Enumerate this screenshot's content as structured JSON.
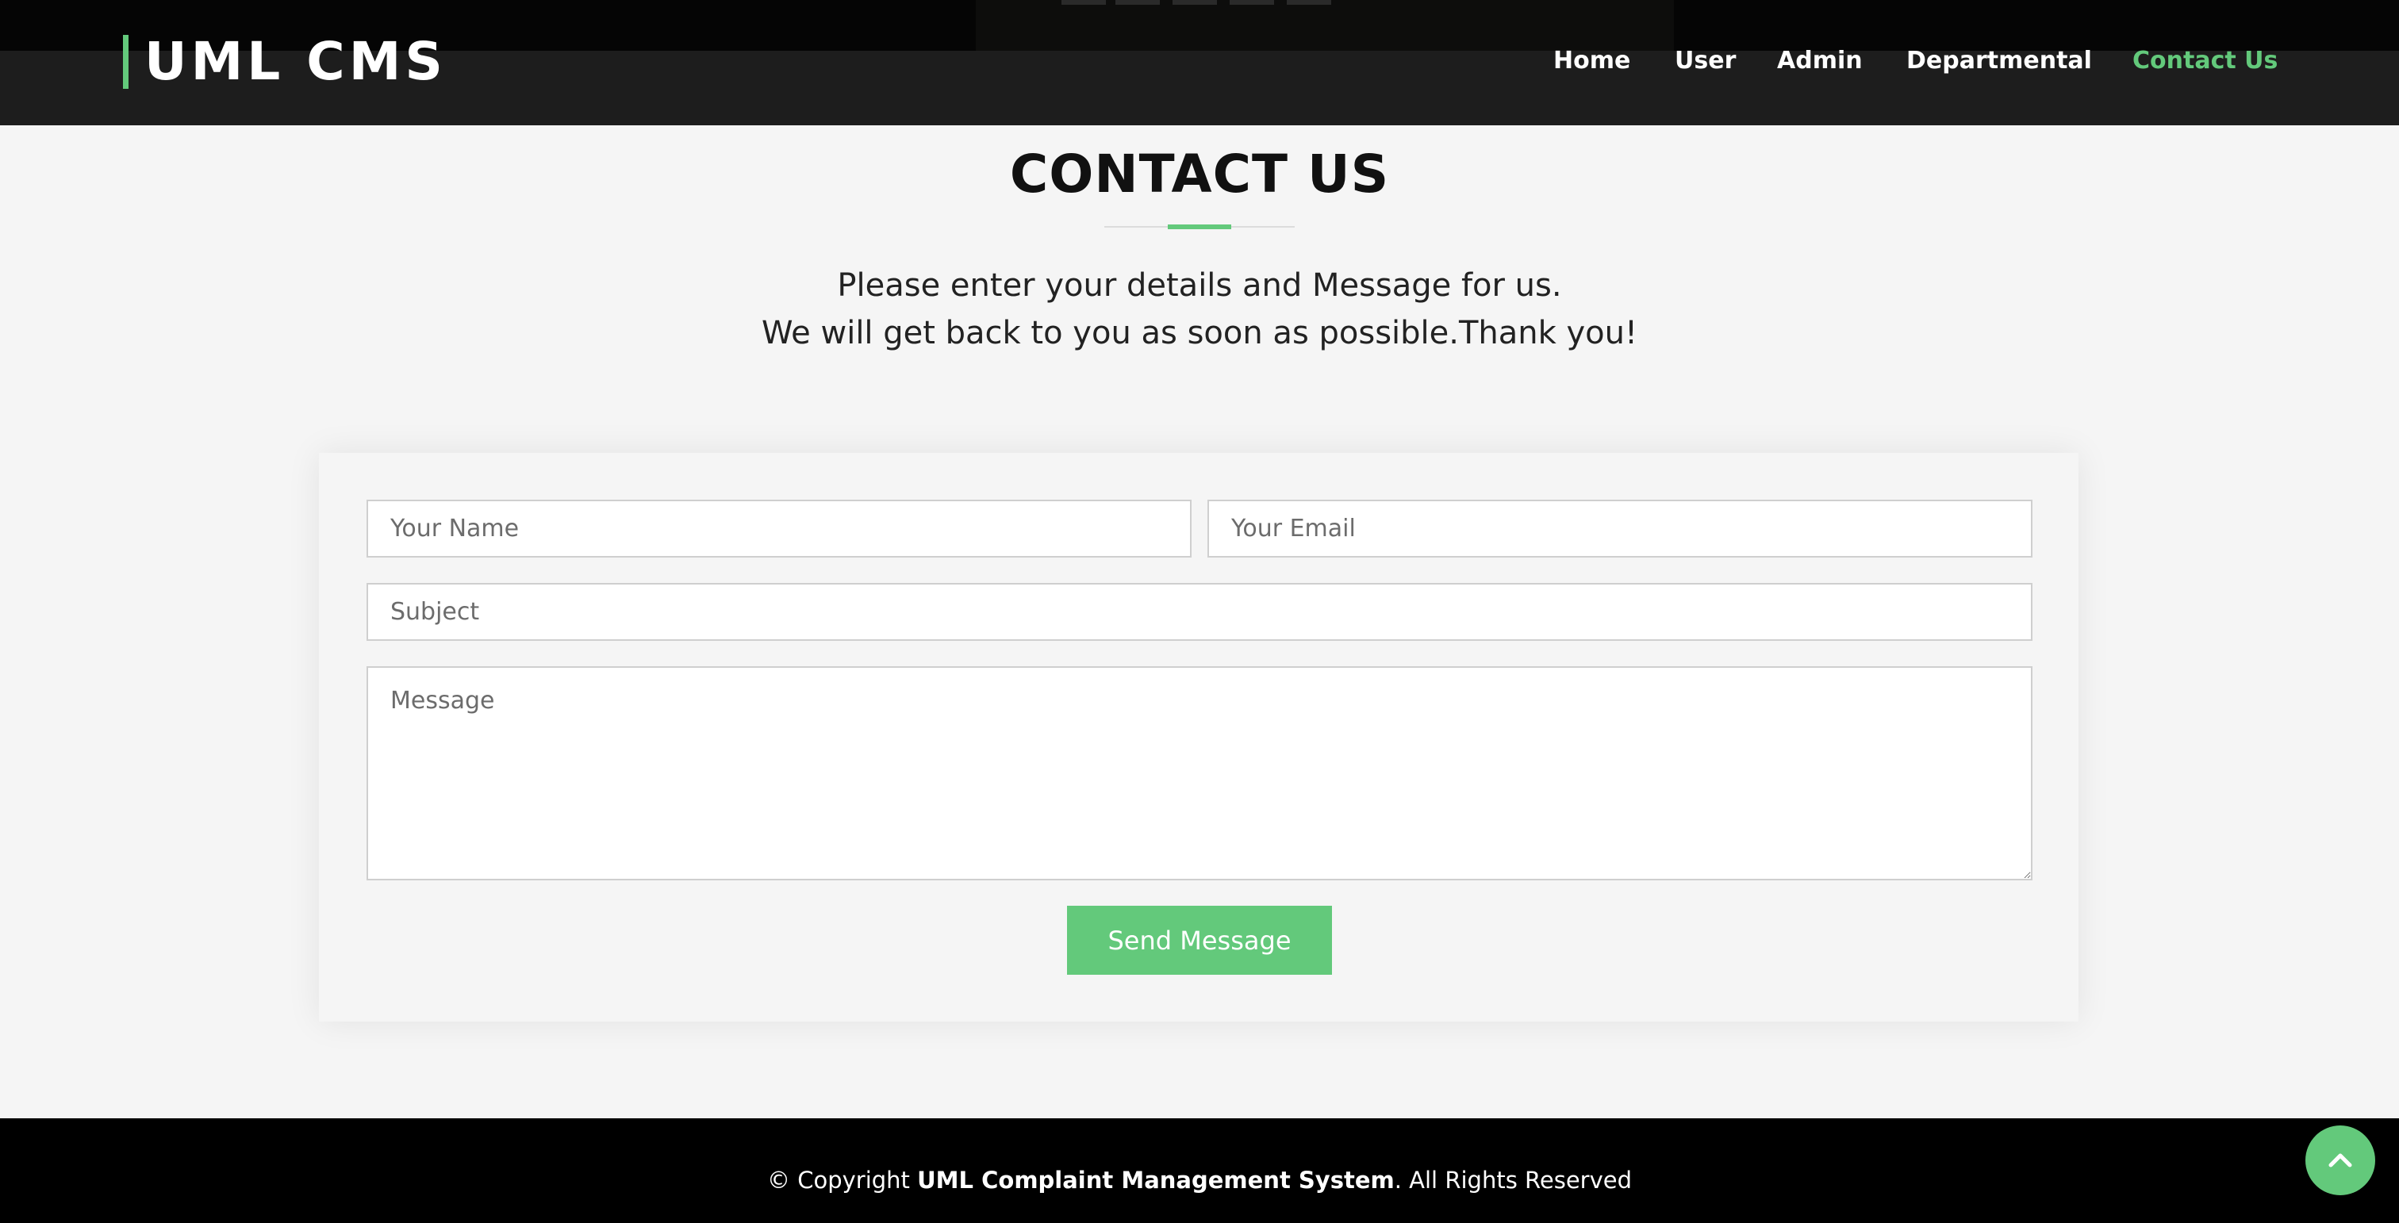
{
  "header": {
    "logo_text": "UML CMS",
    "nav": [
      {
        "label": "Home",
        "active": false
      },
      {
        "label": "User",
        "active": false
      },
      {
        "label": "Admin",
        "active": false
      },
      {
        "label": "Departmental",
        "active": false
      },
      {
        "label": "Contact Us",
        "active": true
      }
    ]
  },
  "section": {
    "title": "CONTACT US",
    "intro_line1": "Please enter your details and Message for us.",
    "intro_line2": "We will get back to you as soon as possible.Thank you!"
  },
  "form": {
    "name_placeholder": "Your Name",
    "email_placeholder": "Your Email",
    "subject_placeholder": "Subject",
    "message_placeholder": "Message",
    "submit_label": "Send Message"
  },
  "footer": {
    "prefix": "© Copyright ",
    "site_name": "UML Complaint Management System",
    "suffix": ". All Rights Reserved"
  },
  "colors": {
    "accent": "#63c97b",
    "header_bg": "#1d1d1d",
    "page_bg": "#f5f5f5",
    "footer_bg": "#000000"
  },
  "icons": {
    "back_to_top": "chevron-up-icon"
  }
}
